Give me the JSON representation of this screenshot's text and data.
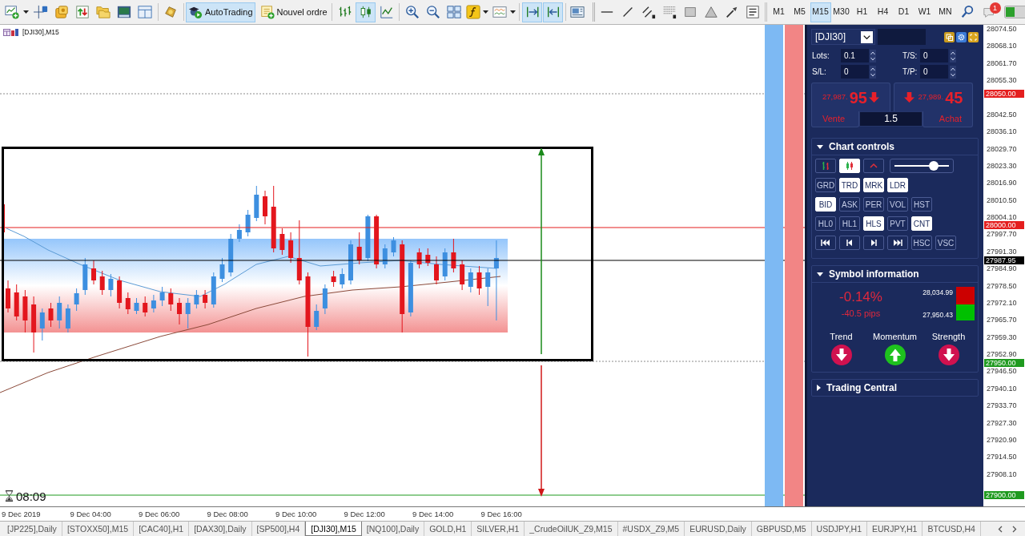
{
  "toolbar": {
    "autotrading": {
      "label": "AutoTrading",
      "on": true
    },
    "new_order": {
      "label": "Nouvel ordre"
    },
    "chart_types": [
      {
        "kind": "bars",
        "selected": false
      },
      {
        "kind": "candles",
        "selected": true
      },
      {
        "kind": "line",
        "selected": false
      }
    ],
    "view_toggles": [
      {
        "kind": "auto-scroll",
        "on": true
      },
      {
        "kind": "chart-shift",
        "on": true
      }
    ],
    "timeframes": [
      {
        "label": "M1",
        "selected": false
      },
      {
        "label": "M5",
        "selected": false
      },
      {
        "label": "M15",
        "selected": true
      },
      {
        "label": "M30",
        "selected": false
      },
      {
        "label": "H1",
        "selected": false
      },
      {
        "label": "H4",
        "selected": false
      },
      {
        "label": "D1",
        "selected": false
      },
      {
        "label": "W1",
        "selected": false
      },
      {
        "label": "MN",
        "selected": false
      }
    ],
    "notification_count": "1"
  },
  "chart": {
    "title": "[DJI30],M15",
    "timer": "08:09",
    "price_axis": [
      "28074.50",
      "28068.10",
      "28061.70",
      "28055.30",
      "28042.50",
      "28036.10",
      "28029.70",
      "28023.30",
      "28016.90",
      "28010.50",
      "28004.10",
      "27997.70",
      "27991.30",
      "27984.90",
      "27978.50",
      "27972.10",
      "27965.70",
      "27959.30",
      "27952.90",
      "27946.50",
      "27940.10",
      "27933.70",
      "27927.30",
      "27920.90",
      "27914.50",
      "27908.10"
    ],
    "price_lines": [
      {
        "label": "28050.00",
        "color": "#e41e1e",
        "kind": "dotted"
      },
      {
        "label": "28000.00",
        "color": "#e41e1e",
        "kind": "solid"
      },
      {
        "label": "27987.95",
        "color": "#000000",
        "kind": "solid"
      },
      {
        "label": "27950.00",
        "color": "#1f9a1f",
        "kind": "dotted"
      },
      {
        "label": "27900.00",
        "color": "#1f9a1f",
        "kind": "solid"
      }
    ],
    "time_axis": [
      "9 Dec 2019",
      "9 Dec 04:00",
      "9 Dec 06:00",
      "9 Dec 08:00",
      "9 Dec 10:00",
      "9 Dec 12:00",
      "9 Dec 14:00",
      "9 Dec 16:00"
    ]
  },
  "trade_panel": {
    "symbol": "[DJI30]",
    "lots": {
      "label": "Lots:",
      "value": "0.1"
    },
    "ts": {
      "label": "T/S:",
      "value": "0"
    },
    "sl": {
      "label": "S/L:",
      "value": "0"
    },
    "tp": {
      "label": "T/P:",
      "value": "0"
    },
    "sell": {
      "price": "27,987.",
      "pips": "95",
      "up": false,
      "label": "Vente"
    },
    "buy": {
      "price": "27,989.",
      "pips": "45",
      "up": false,
      "label": "Achat"
    },
    "spread": "1.5"
  },
  "chart_controls": {
    "title": "Chart controls",
    "expanded": true,
    "chart_types": [
      {
        "kind": "bars",
        "on": false
      },
      {
        "kind": "candles",
        "on": true
      },
      {
        "kind": "line",
        "on": false
      }
    ],
    "zoom": {
      "level": 0.75
    },
    "rows": [
      {
        "buttons": [
          {
            "kind": "label",
            "label": "GRD",
            "on": false
          },
          {
            "kind": "label",
            "label": "TRD",
            "on": true
          },
          {
            "kind": "label",
            "label": "MRK",
            "on": true
          },
          {
            "kind": "label",
            "label": "LDR",
            "on": true
          }
        ]
      },
      {
        "buttons": [
          {
            "kind": "label",
            "label": "BID",
            "on": true
          },
          {
            "kind": "label",
            "label": "ASK",
            "on": false
          },
          {
            "kind": "label",
            "label": "PER",
            "on": false
          },
          {
            "kind": "label",
            "label": "VOL",
            "on": false
          },
          {
            "kind": "label",
            "label": "HST",
            "on": false
          }
        ]
      },
      {
        "buttons": [
          {
            "kind": "label",
            "label": "HL0",
            "on": false
          },
          {
            "kind": "label",
            "label": "HL1",
            "on": false
          },
          {
            "kind": "label",
            "label": "HLS",
            "on": true
          },
          {
            "kind": "label",
            "label": "PVT",
            "on": false
          },
          {
            "kind": "label",
            "label": "CNT",
            "on": true
          }
        ]
      },
      {
        "buttons": [
          {
            "kind": "first",
            "on": false
          },
          {
            "kind": "prev",
            "on": false
          },
          {
            "kind": "next",
            "on": false
          },
          {
            "kind": "last",
            "on": false
          },
          {
            "kind": "label",
            "label": "HSC",
            "on": false
          },
          {
            "kind": "label",
            "label": "VSC",
            "on": false
          }
        ]
      }
    ]
  },
  "symbol_information": {
    "title": "Symbol information",
    "expanded": true,
    "change": "-0.14%",
    "pips": "-40.5 pips",
    "high": "28,034.99",
    "low": "27,950.43",
    "signals": [
      {
        "label": "Trend",
        "up": false
      },
      {
        "label": "Momentum",
        "up": true
      },
      {
        "label": "Strength",
        "up": false
      }
    ]
  },
  "trading_central": {
    "title": "Trading Central",
    "expanded": false
  },
  "symbol_tabs": [
    {
      "label": "[JP225],Daily",
      "selected": false
    },
    {
      "label": "[STOXX50],M15",
      "selected": false
    },
    {
      "label": "[CAC40],H1",
      "selected": false
    },
    {
      "label": "[DAX30],Daily",
      "selected": false
    },
    {
      "label": "[SP500],H4",
      "selected": false
    },
    {
      "label": "[DJI30],M15",
      "selected": true
    },
    {
      "label": "[NQ100],Daily",
      "selected": false
    },
    {
      "label": "GOLD,H1",
      "selected": false
    },
    {
      "label": "SILVER,H1",
      "selected": false
    },
    {
      "label": "_CrudeOilUK_Z9,M15",
      "selected": false
    },
    {
      "label": "#USDX_Z9,M5",
      "selected": false
    },
    {
      "label": "EURUSD,Daily",
      "selected": false
    },
    {
      "label": "GBPUSD,M5",
      "selected": false
    },
    {
      "label": "USDJPY,H1",
      "selected": false
    },
    {
      "label": "EURJPY,H1",
      "selected": false
    },
    {
      "label": "BTCUSD,H4",
      "selected": false
    }
  ]
}
